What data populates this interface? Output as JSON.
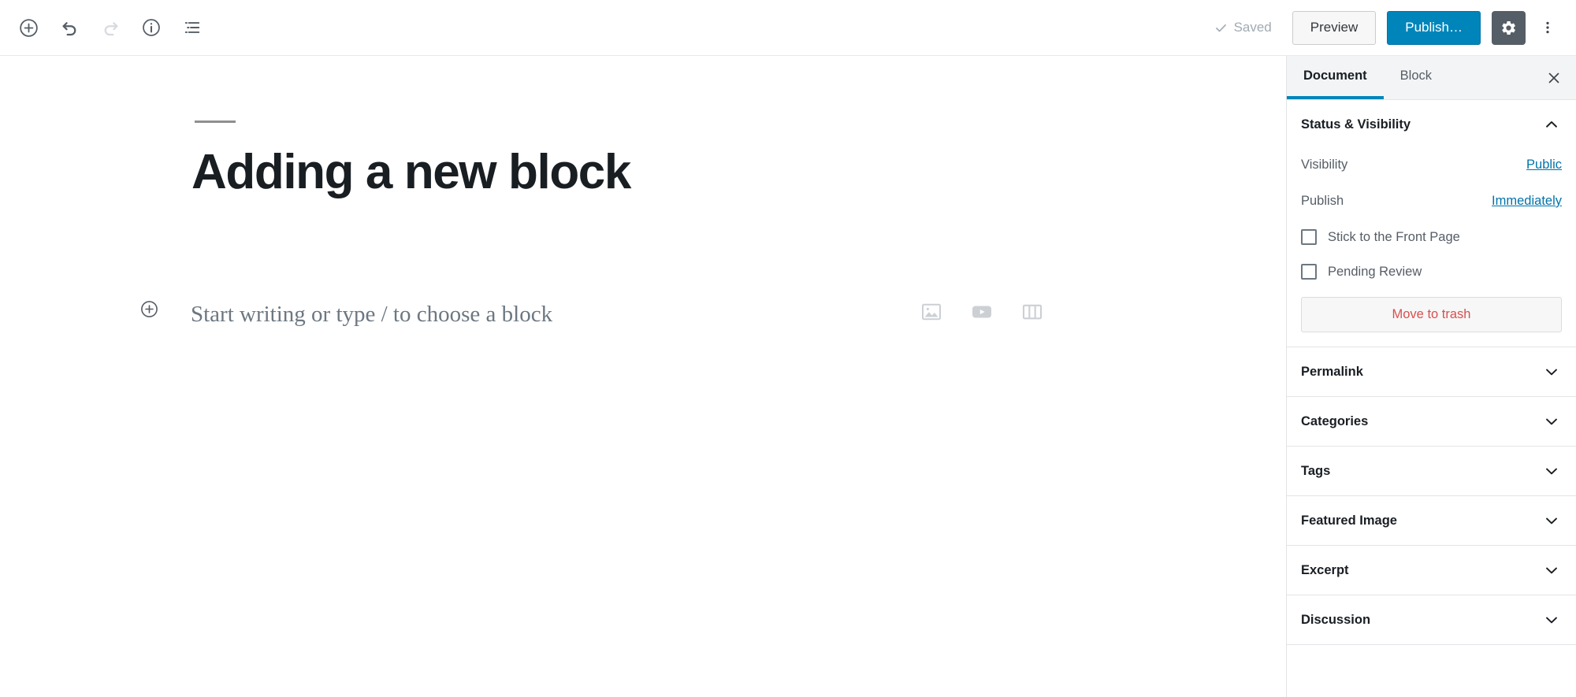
{
  "header": {
    "left_tools": [
      {
        "name": "block-inserter-icon",
        "label": "Add block",
        "disabled": false
      },
      {
        "name": "undo-icon",
        "label": "Undo",
        "disabled": false
      },
      {
        "name": "redo-icon",
        "label": "Redo",
        "disabled": true
      },
      {
        "name": "info-icon",
        "label": "Content structure",
        "disabled": false
      },
      {
        "name": "block-navigation-icon",
        "label": "Block navigation",
        "disabled": false
      }
    ],
    "saved_label": "Saved",
    "preview_label": "Preview",
    "publish_label": "Publish…",
    "settings_icon": "gear-icon",
    "more_icon": "kebab-menu-icon",
    "accent_color": "#0085ba",
    "gear_bg_color": "#555d66"
  },
  "editor": {
    "post_title": "Adding a new block",
    "placeholder": "Start writing or type / to choose a block",
    "inserter_icon": "circle-plus-icon",
    "shortcuts": [
      {
        "name": "image-block-icon",
        "label": "Image"
      },
      {
        "name": "video-block-icon",
        "label": "Video"
      },
      {
        "name": "columns-block-icon",
        "label": "Columns"
      }
    ]
  },
  "sidebar": {
    "tabs": [
      {
        "label": "Document",
        "active": true
      },
      {
        "label": "Block",
        "active": false
      }
    ],
    "close_icon": "close-icon",
    "status_panel": {
      "title": "Status & Visibility",
      "expanded": true,
      "chevron": "chevron-up-icon",
      "visibility_label": "Visibility",
      "visibility_value": "Public",
      "publish_label": "Publish",
      "publish_value": "Immediately",
      "sticky_label": "Stick to the Front Page",
      "sticky_checked": false,
      "pending_label": "Pending Review",
      "pending_checked": false,
      "trash_label": "Move to trash",
      "trash_color": "#d94f4f",
      "link_color": "#0073aa"
    },
    "panels": [
      {
        "label": "Permalink",
        "chevron": "chevron-down-icon"
      },
      {
        "label": "Categories",
        "chevron": "chevron-down-icon"
      },
      {
        "label": "Tags",
        "chevron": "chevron-down-icon"
      },
      {
        "label": "Featured Image",
        "chevron": "chevron-down-icon"
      },
      {
        "label": "Excerpt",
        "chevron": "chevron-down-icon"
      },
      {
        "label": "Discussion",
        "chevron": "chevron-down-icon"
      }
    ]
  }
}
